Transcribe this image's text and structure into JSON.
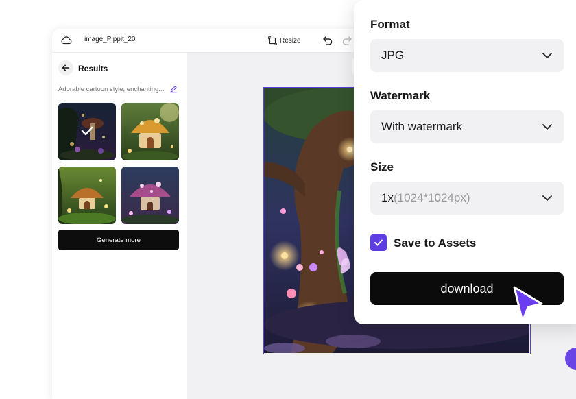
{
  "header": {
    "file_name": "image_Pippit_20",
    "resize_label": "Resize"
  },
  "sidebar": {
    "title": "Results",
    "prompt": "Adorable cartoon style, enchanting...",
    "generate_more_label": "Generate more",
    "thumbnails": [
      {
        "name": "fairy-forest-1",
        "selected": true
      },
      {
        "name": "mushroom-house-1",
        "selected": false
      },
      {
        "name": "mushroom-house-2",
        "selected": false
      },
      {
        "name": "mushroom-house-3",
        "selected": false
      }
    ]
  },
  "export_panel": {
    "format": {
      "label": "Format",
      "value": "JPG"
    },
    "watermark": {
      "label": "Watermark",
      "value": "With watermark"
    },
    "size": {
      "label": "Size",
      "value": "1x",
      "hint": "(1024*1024px)"
    },
    "save_to_assets": {
      "label": "Save to Assets",
      "checked": true
    },
    "download_label": "download"
  },
  "colors": {
    "accent": "#5d3ee0",
    "download_bg": "#0b0b0b",
    "select_bg": "#f1f1f3"
  }
}
